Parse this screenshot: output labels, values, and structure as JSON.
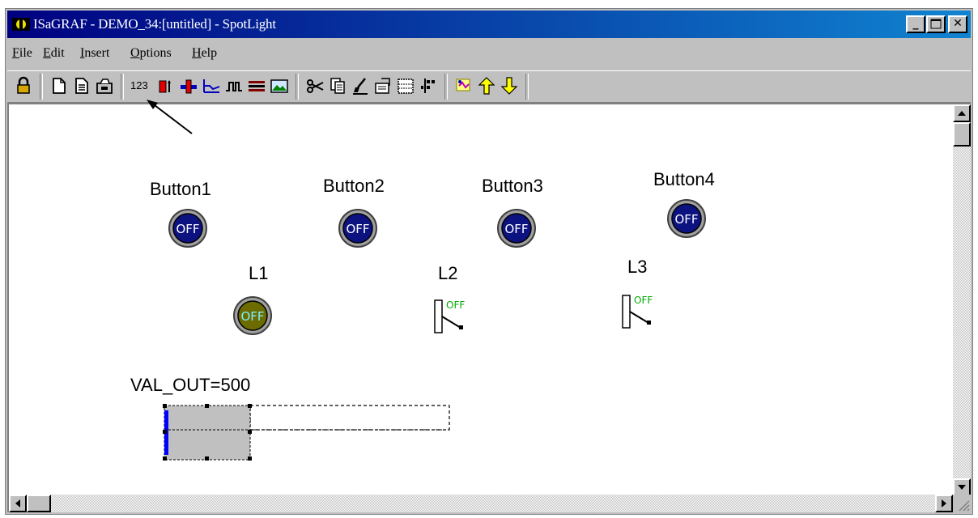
{
  "window": {
    "title": "ISaGRAF - DEMO_34:[untitled] - SpotLight"
  },
  "menu": [
    "File",
    "Edit",
    "Insert",
    "Options",
    "Help"
  ],
  "toolbar": {
    "numeric_label": "123",
    "icons": [
      "lock-icon",
      "new-document-icon",
      "open-document-icon",
      "save-icon",
      "numeric-value-icon",
      "bar-graph-icon",
      "slider-icon",
      "trend-icon",
      "pulse-icon",
      "list-icon",
      "picture-icon",
      "cut-icon",
      "copy-icon",
      "paint-icon",
      "properties-icon",
      "grid-icon",
      "align-icon",
      "image-icon",
      "move-up-icon",
      "move-down-icon"
    ]
  },
  "canvas": {
    "buttons": [
      {
        "label": "Button1",
        "state": "OFF"
      },
      {
        "label": "Button2",
        "state": "OFF"
      },
      {
        "label": "Button3",
        "state": "OFF"
      },
      {
        "label": "Button4",
        "state": "OFF"
      }
    ],
    "lamps": [
      {
        "label": "L1",
        "state": "OFF"
      },
      {
        "label": "L2",
        "state": "OFF"
      },
      {
        "label": "L3",
        "state": "OFF"
      }
    ],
    "value_display": {
      "label": "VAL_OUT=500"
    }
  },
  "colors": {
    "title_start": "#000080",
    "title_end": "#1084d0",
    "button_fill": "#0c1280",
    "lamp_fill": "#6b6b00",
    "lamp_text": "#7ef0ff",
    "switch_text": "#00aa00",
    "bar_fill": "#c0c0c0",
    "bar_indicator": "#0000ff"
  }
}
